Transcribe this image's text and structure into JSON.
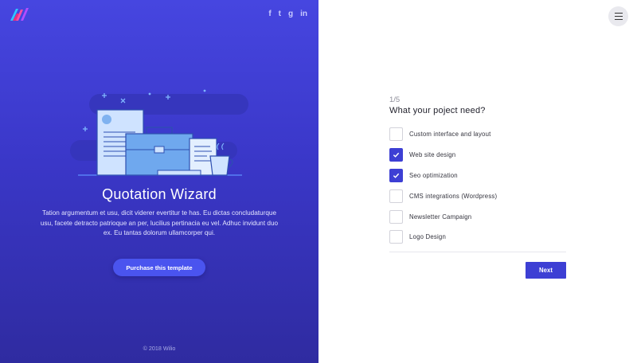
{
  "brand": {
    "logo_icon": "brand-logo-icon"
  },
  "social": [
    "f",
    "t",
    "g",
    "in"
  ],
  "hero": {
    "title": "Quotation Wizard",
    "description": "Tation argumentum et usu, dicit viderer evertitur te has. Eu dictas concludaturque usu, facete detracto patrioque an per, lucilius pertinacia eu vel. Adhuc invidunt duo ex. Eu tantas dolorum ullamcorper qui.",
    "button": "Purchase this template"
  },
  "footer": "© 2018 Wilio",
  "wizard": {
    "step": "1/5",
    "question": "What your poject need?",
    "options": [
      {
        "label": "Custom interface and layout",
        "checked": false
      },
      {
        "label": "Web site design",
        "checked": true
      },
      {
        "label": "Seo optimization",
        "checked": true
      },
      {
        "label": "CMS integrations (Wordpress)",
        "checked": false
      },
      {
        "label": "Newsletter Campaign",
        "checked": false
      },
      {
        "label": "Logo Design",
        "checked": false
      }
    ],
    "next_label": "Next"
  },
  "colors": {
    "accent": "#3d3fd4",
    "panel_top": "#4646e0",
    "panel_bottom": "#2f2ba0"
  }
}
